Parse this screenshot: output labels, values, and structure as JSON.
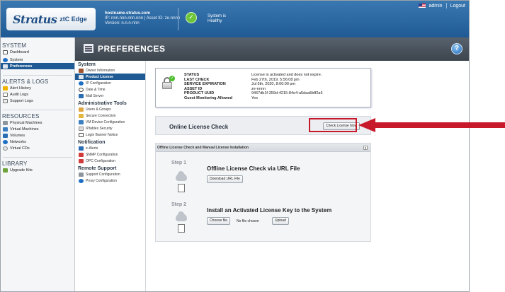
{
  "header": {
    "brand": "Stratus",
    "brand_sub": "ztC Edge",
    "hostname": "hostname.stratus.com",
    "ip_line": "IP: nnn.nnn.nnn.nnn | Asset ID: ze-nnnn",
    "version_line": "Version: n.n.n-nnn",
    "health_line1": "System is",
    "health_line2": "Healthy",
    "user": "admin",
    "logout": "Logout",
    "health_color": "#6dc53a"
  },
  "sidebar": {
    "system_title": "SYSTEM",
    "system_items": [
      {
        "label": "Dashboard",
        "icon": "dashboard-icon"
      },
      {
        "label": "System",
        "icon": "system-icon"
      },
      {
        "label": "Preferences",
        "icon": "preferences-icon"
      }
    ],
    "alerts_title": "ALERTS & LOGS",
    "alerts_items": [
      {
        "label": "Alert History",
        "icon": "alert-icon"
      },
      {
        "label": "Audit Logs",
        "icon": "audit-icon"
      },
      {
        "label": "Support Logs",
        "icon": "support-logs-icon"
      }
    ],
    "resources_title": "RESOURCES",
    "resources_items": [
      {
        "label": "Physical Machines",
        "icon": "physical-machine-icon"
      },
      {
        "label": "Virtual Machines",
        "icon": "virtual-machine-icon"
      },
      {
        "label": "Volumes",
        "icon": "volume-icon"
      },
      {
        "label": "Networks",
        "icon": "network-icon"
      },
      {
        "label": "Virtual CDs",
        "icon": "cd-icon"
      }
    ],
    "library_title": "LIBRARY",
    "library_items": [
      {
        "label": "Upgrade Kits",
        "icon": "upgrade-kit-icon"
      }
    ]
  },
  "main": {
    "title": "PREFERENCES",
    "help": "?"
  },
  "subnav": {
    "system_group": "System",
    "system_items": [
      "Owner Information",
      "Product License",
      "IP Configuration",
      "Date & Time",
      "Mail Server"
    ],
    "admin_group": "Administrative Tools",
    "admin_items": [
      "Users & Groups",
      "Secure Connection",
      "VM Device Configuration",
      "IPtables Security",
      "Login Banner Notice"
    ],
    "notif_group": "Notification",
    "notif_items": [
      "e-Alerts",
      "SNMP Configuration",
      "OPC Configuration"
    ],
    "remote_group": "Remote Support",
    "remote_items": [
      "Support Configuration",
      "Proxy Configuration"
    ]
  },
  "license": {
    "keys": [
      "STATUS",
      "LAST CHECK",
      "SERVICE EXPIRATION",
      "ASSET ID",
      "PRODUCT UUID",
      "Guest Monitoring Allowed"
    ],
    "values": [
      "License is activated and does not expire.",
      "Feb 27th, 2019, 5:56:08 pm",
      "Jul 5th, 2020, 8:00:00 pm",
      "ze-nnnn",
      "9467db1f-359d-4215-84e4-a5daa5bff2a6",
      "Yes"
    ]
  },
  "online_check": {
    "title": "Online License Check",
    "button": "Check License Now"
  },
  "offline": {
    "header": "Offline License Check and Manual License Installation",
    "collapse": "▲",
    "step1_label": "Step 1",
    "step1_title": "Offline License Check via URL File",
    "download_button": "Download URL File",
    "step2_label": "Step 2",
    "step2_title": "Install an Activated License Key to the System",
    "choose_button": "Choose file",
    "no_file": "No file chosen",
    "upload_button": "Upload"
  },
  "colors": {
    "header_blue": "#1f5a94",
    "active_nav": "#1f5a94",
    "highlight_red": "#c8192b"
  }
}
